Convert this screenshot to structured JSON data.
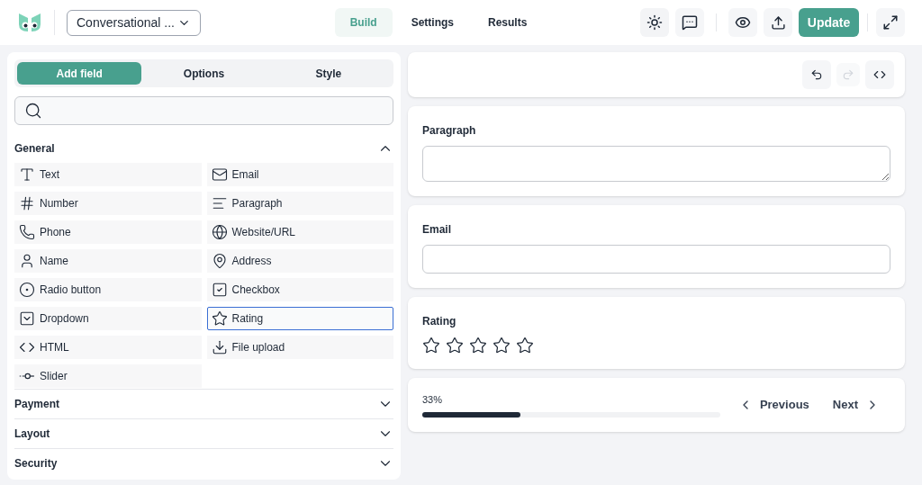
{
  "header": {
    "form_select": {
      "value": "Conversational ..."
    },
    "nav": [
      {
        "label": "Build",
        "selected": true
      },
      {
        "label": "Settings",
        "selected": false
      },
      {
        "label": "Results",
        "selected": false
      }
    ],
    "update_button": "Update"
  },
  "sidebar": {
    "tabs": [
      {
        "label": "Add field",
        "selected": true
      },
      {
        "label": "Options",
        "selected": false
      },
      {
        "label": "Style",
        "selected": false
      }
    ],
    "sections": [
      {
        "title": "General",
        "expanded": true,
        "fields": [
          {
            "label": "Text",
            "kind": "text",
            "selected": false
          },
          {
            "label": "Email",
            "kind": "email",
            "selected": false
          },
          {
            "label": "Number",
            "kind": "number",
            "selected": false
          },
          {
            "label": "Paragraph",
            "kind": "paragraph",
            "selected": false
          },
          {
            "label": "Phone",
            "kind": "phone",
            "selected": false
          },
          {
            "label": "Website/URL",
            "kind": "url",
            "selected": false
          },
          {
            "label": "Name",
            "kind": "name",
            "selected": false
          },
          {
            "label": "Address",
            "kind": "address",
            "selected": false
          },
          {
            "label": "Radio button",
            "kind": "radio",
            "selected": false
          },
          {
            "label": "Checkbox",
            "kind": "checkbox",
            "selected": false
          },
          {
            "label": "Dropdown",
            "kind": "dropdown",
            "selected": false
          },
          {
            "label": "Rating",
            "kind": "rating",
            "selected": true
          },
          {
            "label": "HTML",
            "kind": "html",
            "selected": false
          },
          {
            "label": "File upload",
            "kind": "file",
            "selected": false
          },
          {
            "label": "Slider",
            "kind": "slider",
            "selected": false
          }
        ]
      },
      {
        "title": "Payment",
        "expanded": false
      },
      {
        "title": "Layout",
        "expanded": false
      },
      {
        "title": "Security",
        "expanded": false
      }
    ]
  },
  "preview": {
    "toolbar": {
      "redo_disabled": true
    },
    "cards": [
      {
        "kind": "textarea",
        "label": "Paragraph"
      },
      {
        "kind": "input",
        "label": "Email"
      },
      {
        "kind": "rating",
        "label": "Rating",
        "stars": 0
      }
    ],
    "progress": {
      "reading": "33%",
      "level": 0.33,
      "previous": "Previous",
      "next": "Next"
    }
  }
}
